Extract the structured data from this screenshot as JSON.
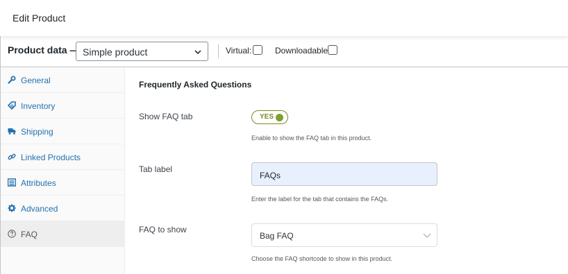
{
  "page": {
    "title": "Edit Product"
  },
  "product_data": {
    "label": "Product data —",
    "type_select": {
      "value": "Simple product"
    },
    "virtual": {
      "label": "Virtual:",
      "checked": false
    },
    "downloadable": {
      "label": "Downloadable:",
      "checked": false
    }
  },
  "tabs": [
    {
      "label": "General",
      "icon": "wrench-icon"
    },
    {
      "label": "Inventory",
      "icon": "tag-icon"
    },
    {
      "label": "Shipping",
      "icon": "truck-icon"
    },
    {
      "label": "Linked Products",
      "icon": "link-icon"
    },
    {
      "label": "Attributes",
      "icon": "list-icon"
    },
    {
      "label": "Advanced",
      "icon": "gear-icon"
    },
    {
      "label": "FAQ",
      "icon": "question-circle-icon",
      "active": true
    }
  ],
  "faq": {
    "section_title": "Frequently Asked Questions",
    "show_faq_tab": {
      "label": "Show FAQ tab",
      "toggle_text": "YES",
      "enabled": true,
      "hint": "Enable to show the FAQ tab in this product."
    },
    "tab_label": {
      "label": "Tab label",
      "value": "FAQs",
      "hint": "Enter the label for the tab that contains the FAQs."
    },
    "faq_to_show": {
      "label": "FAQ to show",
      "value": "Bag FAQ",
      "hint": "Choose the FAQ shortcode to show in this product."
    }
  },
  "colors": {
    "link": "#2271b1",
    "toggle_accent": "#7ea12e",
    "autofill_bg": "#e8f0fe"
  }
}
